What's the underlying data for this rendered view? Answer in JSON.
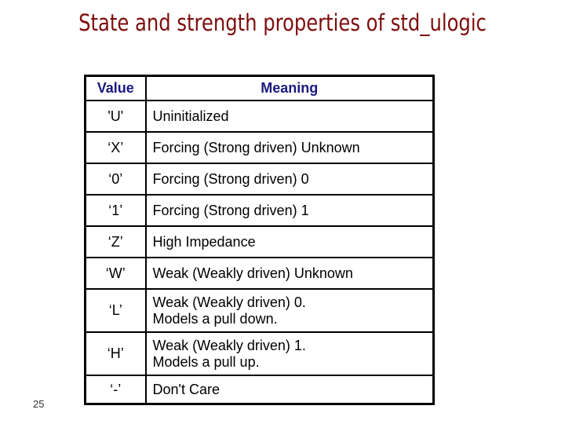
{
  "slide": {
    "title": "State and strength properties of std_ulogic",
    "number": "25"
  },
  "table": {
    "headers": {
      "value": "Value",
      "meaning": "Meaning"
    },
    "rows": [
      {
        "value": "'U'",
        "meaning": [
          "Uninitialized"
        ]
      },
      {
        "value": "‘X’",
        "meaning": [
          "Forcing (Strong driven) Unknown"
        ]
      },
      {
        "value": "‘0’",
        "meaning": [
          "Forcing (Strong driven) 0"
        ]
      },
      {
        "value": "‘1’",
        "meaning": [
          "Forcing (Strong driven) 1"
        ]
      },
      {
        "value": "‘Z’",
        "meaning": [
          "High Impedance"
        ]
      },
      {
        "value": "‘W’",
        "meaning": [
          "Weak (Weakly driven) Unknown"
        ]
      },
      {
        "value": "‘L’",
        "meaning": [
          "Weak (Weakly driven) 0.",
          "Models a pull down."
        ]
      },
      {
        "value": "‘H’",
        "meaning": [
          "Weak (Weakly driven) 1.",
          "Models a pull up."
        ]
      },
      {
        "value": "‘-’",
        "meaning": [
          "Don't Care"
        ]
      }
    ]
  },
  "colors": {
    "title": "#7f0c0c",
    "header_text": "#1a1a80",
    "border": "#000000"
  }
}
